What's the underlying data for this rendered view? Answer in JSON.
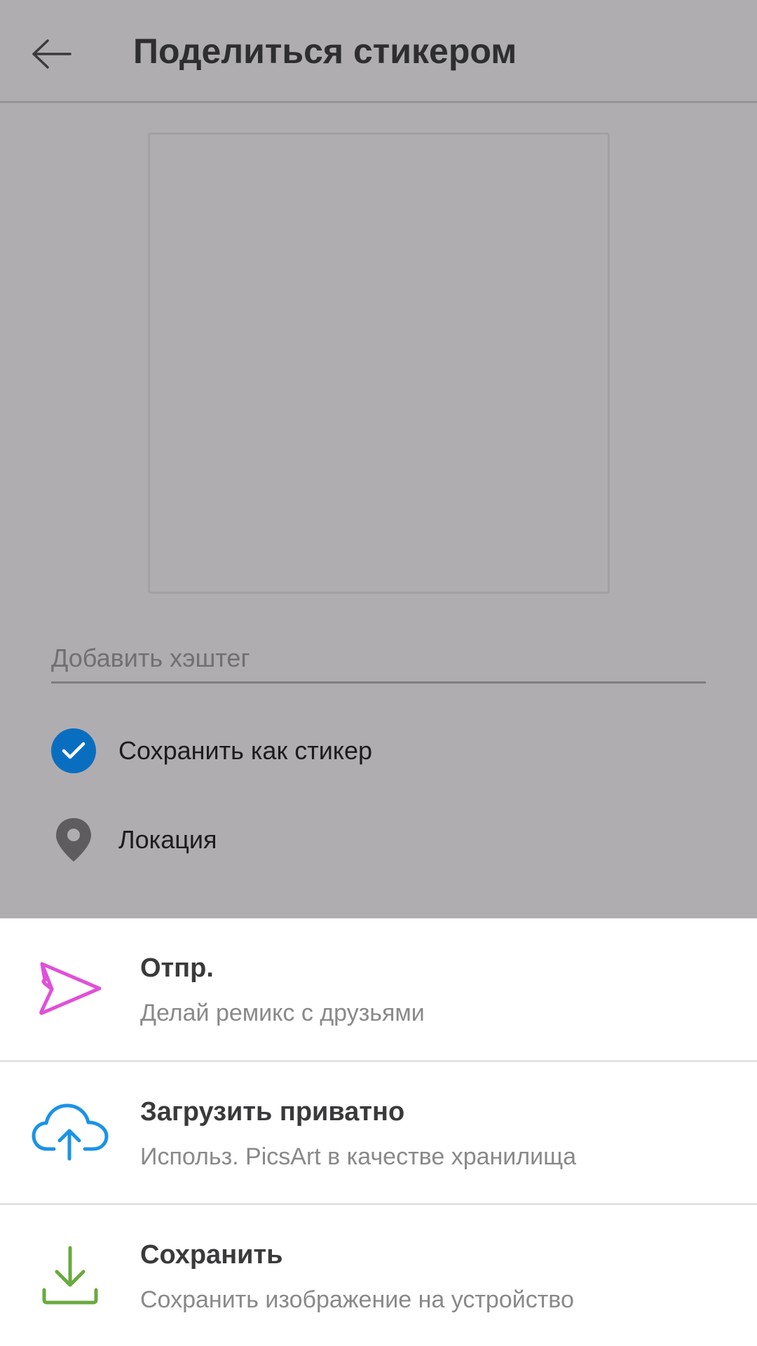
{
  "header": {
    "title": "Поделиться стикером",
    "back_icon": "arrow-left-icon"
  },
  "form": {
    "hashtag_placeholder": "Добавить хэштег",
    "save_as_sticker_label": "Сохранить как стикер",
    "save_as_sticker_checked": true,
    "location_label": "Локация"
  },
  "sheet": {
    "items": [
      {
        "icon": "send-icon",
        "title": "Отпр.",
        "subtitle": "Делай ремикс с друзьями",
        "color": "#e14fd9"
      },
      {
        "icon": "cloud-upload-icon",
        "title": "Загрузить приватно",
        "subtitle": "Использ. PicsArt в качестве хранилища",
        "color": "#1a93e6"
      },
      {
        "icon": "download-icon",
        "title": "Сохранить",
        "subtitle": "Сохранить изображение на устройство",
        "color": "#6aaa3e"
      }
    ]
  },
  "colors": {
    "accent": "#0a6ec0",
    "scrim_background": "#afadb0"
  }
}
